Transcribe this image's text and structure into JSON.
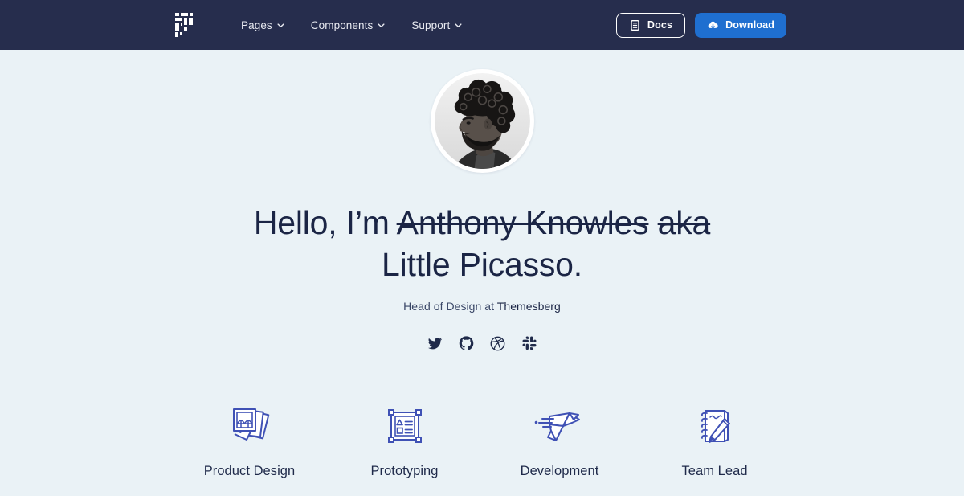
{
  "theme": {
    "navbar_bg": "#262d4d",
    "page_bg": "#eaf2f6",
    "text_dark": "#1f2a4a",
    "heading": "#1b2545",
    "accent_blue": "#1f6fd0",
    "icon_indigo": "#3f51b5"
  },
  "navbar": {
    "logo_name": "themesberg-pixel-logo",
    "links": [
      {
        "label": "Pages",
        "icon": "chevron-down-icon"
      },
      {
        "label": "Components",
        "icon": "chevron-down-icon"
      },
      {
        "label": "Support",
        "icon": "chevron-down-icon"
      }
    ],
    "docs_button": {
      "label": "Docs",
      "icon": "book-icon"
    },
    "download_button": {
      "label": "Download",
      "icon": "cloud-download-icon"
    }
  },
  "hero": {
    "avatar_alt": "black-and-white profile portrait of a bearded man with curly hair",
    "greeting": "Hello, I’m ",
    "struck_name": "Anthony Knowles",
    "struck_aka": "aka",
    "nickname": " Little Picasso.",
    "subtitle_prefix": "Head of Design at ",
    "subtitle_link": "Themesberg",
    "socials": [
      {
        "name": "twitter-icon",
        "label": "Twitter"
      },
      {
        "name": "github-icon",
        "label": "GitHub"
      },
      {
        "name": "dribbble-icon",
        "label": "Dribbble"
      },
      {
        "name": "slack-icon",
        "label": "Slack"
      }
    ]
  },
  "features": [
    {
      "label": "Product Design",
      "icon": "photos-stack-icon"
    },
    {
      "label": "Prototyping",
      "icon": "wireframe-artboard-icon"
    },
    {
      "label": "Development",
      "icon": "origami-bird-icon"
    },
    {
      "label": "Team Lead",
      "icon": "notepad-pencil-icon"
    }
  ]
}
